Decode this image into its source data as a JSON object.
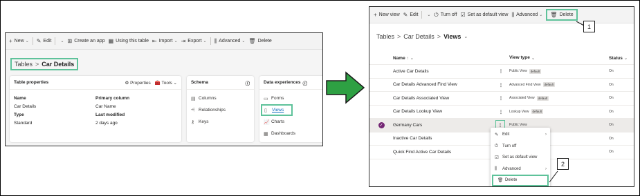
{
  "left": {
    "commandbar": {
      "new": "New",
      "edit": "Edit",
      "create_app": "Create an app",
      "using_table": "Using this table",
      "import": "Import",
      "export": "Export",
      "advanced": "Advanced",
      "delete": "Delete"
    },
    "breadcrumb": {
      "root": "Tables",
      "current": "Car Details"
    },
    "table_properties": {
      "title": "Table properties",
      "properties_action": "Properties",
      "tools_action": "Tools",
      "name_label": "Name",
      "name_value": "Car Details",
      "primary_column_label": "Primary column",
      "primary_column_value": "Car Name",
      "type_label": "Type",
      "type_value": "Standard",
      "last_modified_label": "Last modified",
      "last_modified_value": "2 days ago"
    },
    "schema": {
      "title": "Schema",
      "items": [
        "Columns",
        "Relationships",
        "Keys"
      ]
    },
    "data_experiences": {
      "title": "Data experiences",
      "items": [
        "Forms",
        "Views",
        "Charts",
        "Dashboards"
      ]
    }
  },
  "right": {
    "commandbar": {
      "new_view": "New view",
      "edit": "Edit",
      "turn_off": "Turn off",
      "set_default": "Set as default view",
      "advanced": "Advanced",
      "delete": "Delete"
    },
    "breadcrumb": {
      "root": "Tables",
      "middle": "Car Details",
      "current": "Views"
    },
    "columns": {
      "name": "Name",
      "view_type": "View type",
      "status": "Status"
    },
    "rows": [
      {
        "name": "Active Car Details",
        "type": "Public View",
        "badge": "default",
        "status": "On"
      },
      {
        "name": "Car Details Advanced Find View",
        "type": "Advanced Find View",
        "badge": "default",
        "status": "On"
      },
      {
        "name": "Car Details Associated View",
        "type": "Associated View",
        "badge": "default",
        "status": "On"
      },
      {
        "name": "Car Details Lookup View",
        "type": "Lookup View",
        "badge": "default",
        "status": "On"
      },
      {
        "name": "Germany Cars",
        "type": "Public View",
        "badge": "",
        "status": "On"
      },
      {
        "name": "Inactive Car Details",
        "type": "",
        "badge": "",
        "status": "On"
      },
      {
        "name": "Quick Find Active Car Details",
        "type": "",
        "badge": "",
        "status": "On"
      }
    ],
    "context_menu": {
      "edit": "Edit",
      "turn_off": "Turn off",
      "set_default": "Set as default view",
      "advanced": "Advanced",
      "delete": "Delete"
    }
  },
  "callouts": {
    "one": "1",
    "two": "2"
  },
  "colors": {
    "highlight": "#5ec29a",
    "arrow": "#2ea043",
    "selected_check": "#742774"
  }
}
